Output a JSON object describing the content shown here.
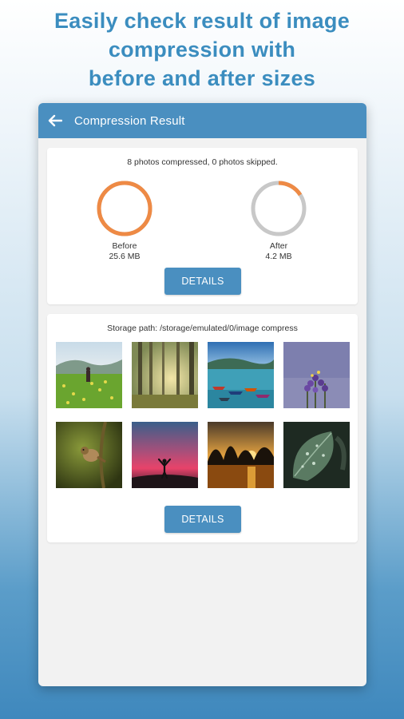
{
  "promo": {
    "line1": "Easily check result of image",
    "line2": "compression with",
    "line3": "before and after sizes"
  },
  "appbar": {
    "title": "Compression Result",
    "back_icon": "arrow-left-icon"
  },
  "summary": {
    "status_text": "8 photos compressed, 0 photos skipped.",
    "before": {
      "label": "Before",
      "size": "25.6 MB",
      "fill_fraction": 1.0
    },
    "after": {
      "label": "After",
      "size": "4.2 MB",
      "fill_fraction": 0.16
    },
    "details_label": "DETAILS"
  },
  "gallery": {
    "storage_path": "Storage path: /storage/emulated/0/image compress",
    "details_label": "DETAILS",
    "thumbnails": [
      {
        "name": "field-person"
      },
      {
        "name": "misty-forest"
      },
      {
        "name": "lake-boats"
      },
      {
        "name": "purple-flowers"
      },
      {
        "name": "bird-on-branch"
      },
      {
        "name": "sunset-silhouette"
      },
      {
        "name": "sunset-lake-trees"
      },
      {
        "name": "leaf-drops"
      }
    ]
  },
  "colors": {
    "accent": "#4a8fc0",
    "gauge_fill": "#ee8a45",
    "gauge_track": "#c8c8c8",
    "promo_text": "#3b8dbf"
  }
}
